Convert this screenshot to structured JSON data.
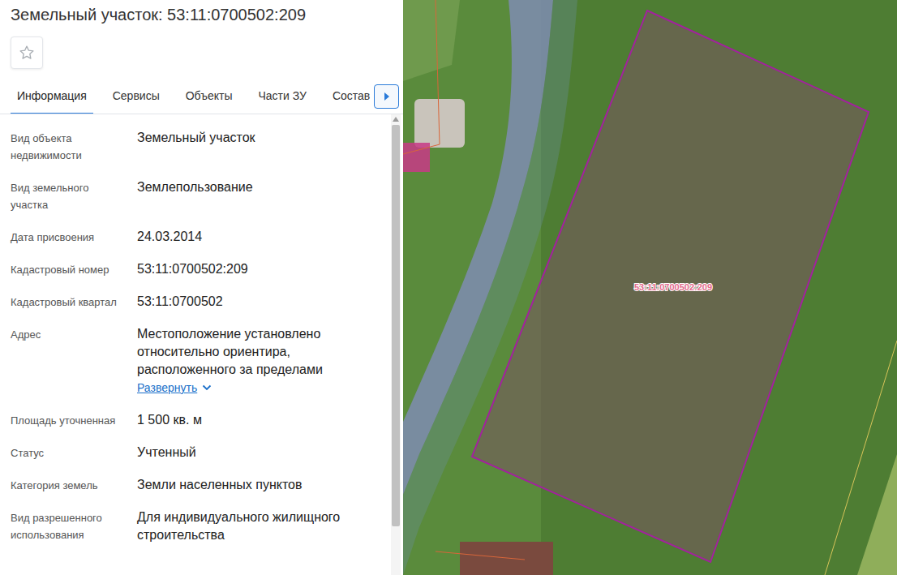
{
  "header": {
    "title": "Земельный участок: 53:11:0700502:209",
    "favorite": false
  },
  "tabs": [
    {
      "label": "Информация",
      "selected": true
    },
    {
      "label": "Сервисы",
      "selected": false
    },
    {
      "label": "Объекты",
      "selected": false
    },
    {
      "label": "Части ЗУ",
      "selected": false
    },
    {
      "label": "Состав",
      "selected": false
    }
  ],
  "fields": [
    {
      "label": "Вид объекта недвижимости",
      "value": "Земельный участок"
    },
    {
      "label": "Вид земельного участка",
      "value": "Землепользование"
    },
    {
      "label": "Дата присвоения",
      "value": "24.03.2014"
    },
    {
      "label": "Кадастровый номер",
      "value": "53:11:0700502:209"
    },
    {
      "label": "Кадастровый квартал",
      "value": "53:11:0700502"
    },
    {
      "label": "Адрес",
      "value": "Местоположение установлено относительно ориентира, расположенного за пределами",
      "link": "Развернуть",
      "expanded": false
    },
    {
      "label": "Площадь уточненная",
      "value": "1 500 кв. м"
    },
    {
      "label": "Статус",
      "value": "Учтенный"
    },
    {
      "label": "Категория земель",
      "value": "Земли населенных пунктов"
    },
    {
      "label": "Вид разрешенного использования",
      "value": "Для индивидуального жилищного строительства"
    }
  ],
  "map": {
    "parcel_label": "53:11:0700502:209"
  }
}
